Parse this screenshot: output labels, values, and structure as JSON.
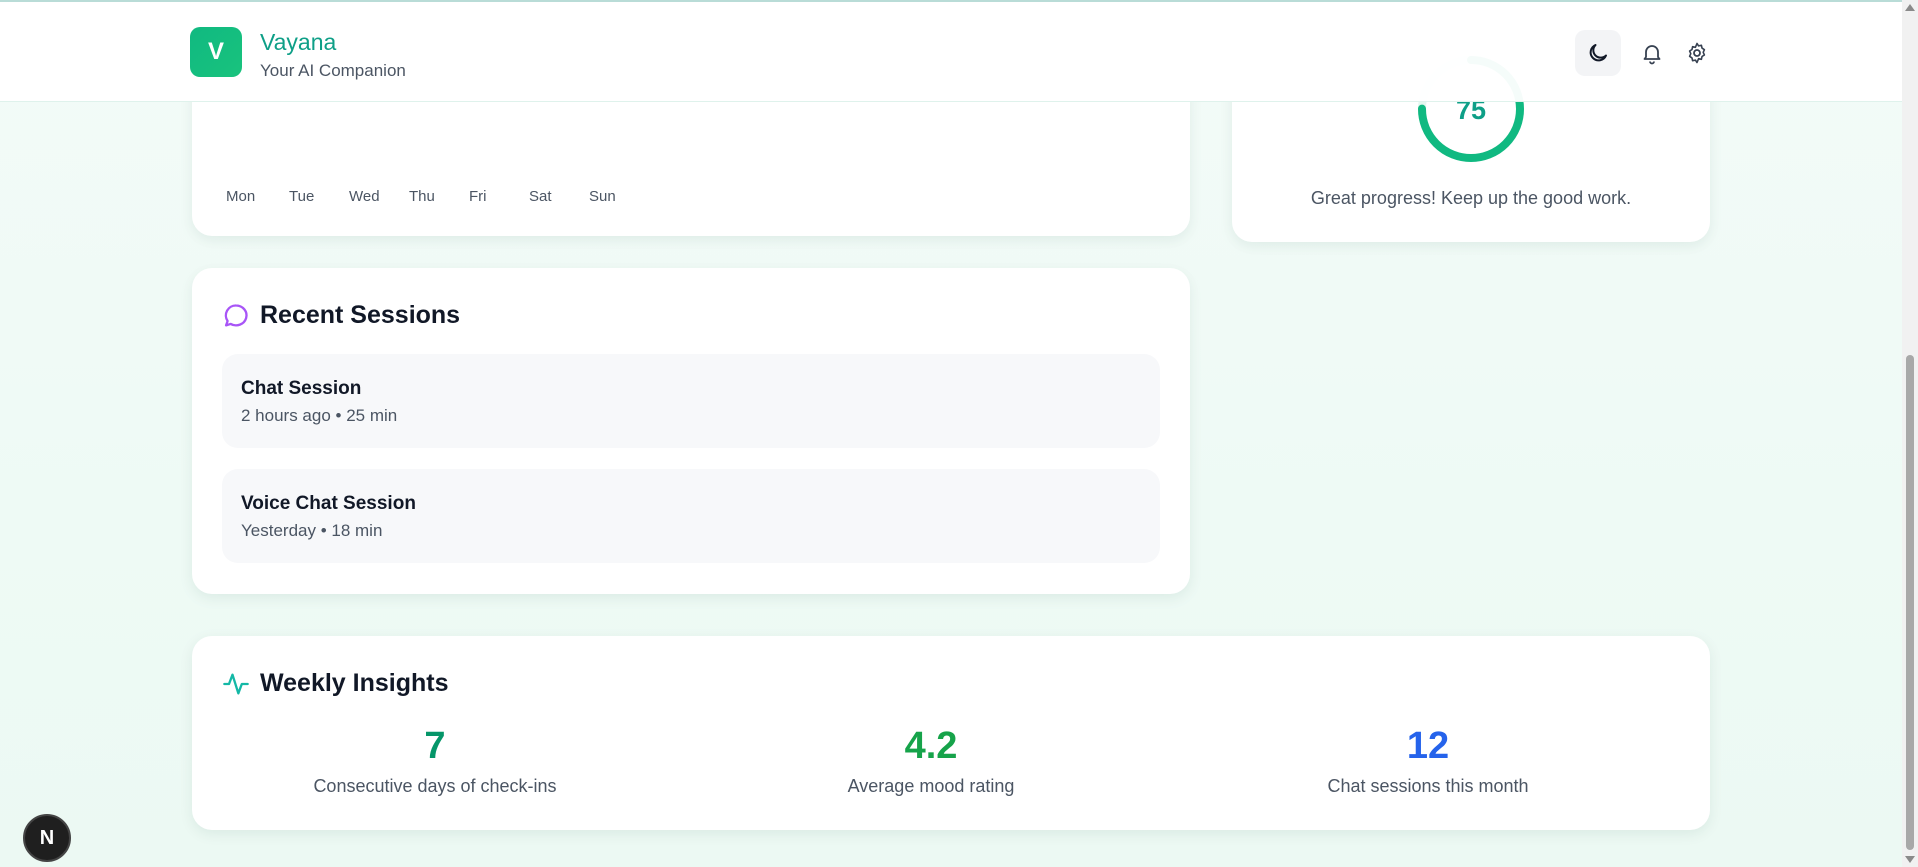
{
  "header": {
    "logo_letter": "V",
    "brand_name": "Vayana",
    "tagline": "Your AI Companion"
  },
  "mood_week": {
    "days": [
      "Mon",
      "Tue",
      "Wed",
      "Thu",
      "Fri",
      "Sat",
      "Sun"
    ]
  },
  "wellness": {
    "score": "75",
    "score_fraction": 0.75,
    "caption": "Great progress! Keep up the good work."
  },
  "sessions": {
    "title": "Recent Sessions",
    "items": [
      {
        "title": "Chat Session",
        "meta": "2 hours ago • 25 min"
      },
      {
        "title": "Voice Chat Session",
        "meta": "Yesterday • 18 min"
      }
    ]
  },
  "insights": {
    "title": "Weekly Insights",
    "stats": [
      {
        "value": "7",
        "label": "Consecutive days of check-ins",
        "color": "#059669"
      },
      {
        "value": "4.2",
        "label": "Average mood rating",
        "color": "#16a34a"
      },
      {
        "value": "12",
        "label": "Chat sessions this month",
        "color": "#2563eb"
      }
    ]
  },
  "dev_badge": {
    "letter": "N"
  },
  "colors": {
    "brand": "#0e9f87",
    "ring": "#10b981",
    "sessions_icon": "#a855f7",
    "insights_icon": "#14b8a6"
  }
}
